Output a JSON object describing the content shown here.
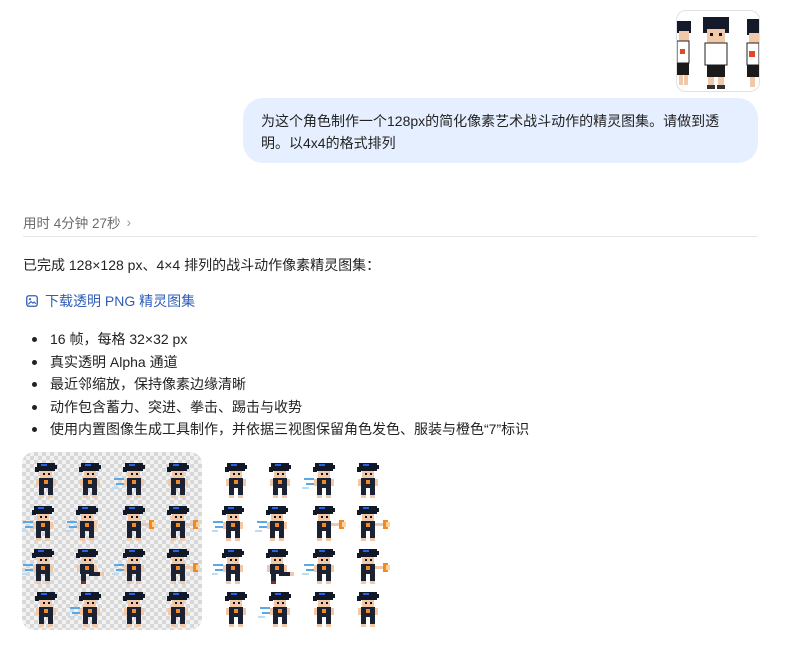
{
  "user_message": {
    "line1": "为这个角色制作一个128px的简化像素艺术战斗动作的精灵图集。请做到透",
    "line2": "明。以4x4的格式排列"
  },
  "assistant": {
    "timing": "用时 4分钟 27秒",
    "intro": "已完成 128×128 px、4×4 排列的战斗动作像素精灵图集：",
    "download_label": "下载透明 PNG 精灵图集",
    "bullets": [
      "16 帧，每格 32×32 px",
      "真实透明 Alpha 通道",
      "最近邻缩放，保持像素边缘清晰",
      "动作包含蓄力、突进、拳击、踢击与收势",
      "使用内置图像生成工具制作，并依据三视图保留角色发色、服装与橙色“7”标识"
    ]
  },
  "sprite_sheet": {
    "grid": "4x4",
    "frames": [
      "stance",
      "stance",
      "energy",
      "stance",
      "dash",
      "dash",
      "punch",
      "punch",
      "dash",
      "kick",
      "energy",
      "punch",
      "stance",
      "energy",
      "stance",
      "stance"
    ]
  },
  "colors": {
    "bubble": "#e6efff",
    "link": "#2f5db8",
    "hair": "#111827",
    "hair_highlight": "#2563eb",
    "skin": "#f2c9a8",
    "energy": "#5aa9e6",
    "impact": "#f08a24"
  }
}
